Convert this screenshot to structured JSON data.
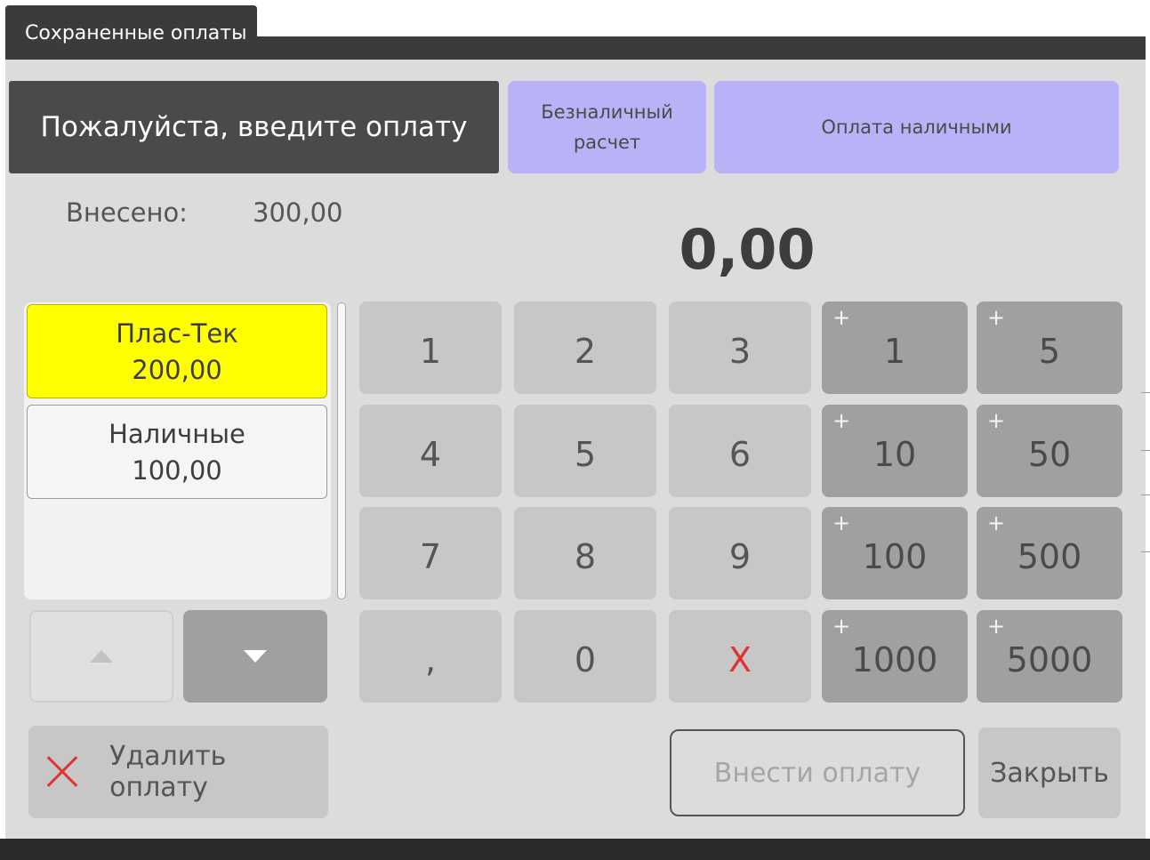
{
  "window": {
    "tab_title": "Сохраненные оплаты"
  },
  "header": {
    "prompt": "Пожалуйста, введите оплату",
    "methods": [
      {
        "label_line1": "Безналичный",
        "label_line2": "расчет"
      },
      {
        "label_line1": "Оплата наличными",
        "label_line2": ""
      }
    ]
  },
  "summary": {
    "paid_label": "Внесено:",
    "paid_value": "300,00",
    "entry_amount": "0,00"
  },
  "payments": [
    {
      "name": "Плас-Тек",
      "amount": "200,00",
      "selected": true
    },
    {
      "name": "Наличные",
      "amount": "100,00",
      "selected": false
    }
  ],
  "keypad": {
    "digits": [
      "1",
      "2",
      "3",
      "4",
      "5",
      "6",
      "7",
      "8",
      "9",
      ",",
      "0",
      "X"
    ],
    "quick_add_prefix": "+",
    "quick_add": [
      "1",
      "5",
      "10",
      "50",
      "100",
      "500",
      "1000",
      "5000"
    ]
  },
  "actions": {
    "delete_label": "Удалить оплату",
    "submit_label": "Внести оплату",
    "close_label": "Закрыть"
  },
  "colors": {
    "selected_payment": "#ffff00",
    "method_button": "#b8b3f7",
    "clear_key": "#e33232",
    "header_dark": "#4a4a4a"
  }
}
